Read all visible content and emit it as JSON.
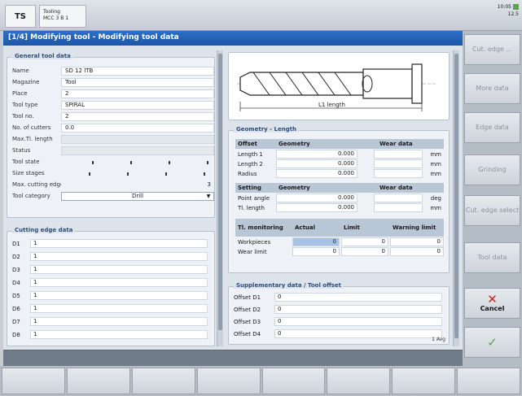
{
  "header": {
    "ts_label": "TS",
    "channel_line1": "Tooling",
    "channel_line2": "MCC 3 B 1",
    "status_line1": "10:05",
    "status_line2": "12.5"
  },
  "title": "[1/4] Modifying tool - Modifying tool data",
  "general": {
    "title": "General tool data",
    "rows": [
      {
        "label": "Name",
        "value": "SD 12 ITB"
      },
      {
        "label": "Magazine",
        "value": "Tool"
      },
      {
        "label": "Place",
        "value": "2"
      },
      {
        "label": "Tool type",
        "value": "SPIRAL"
      },
      {
        "label": "Tool no.",
        "value": "2"
      },
      {
        "label": "No. of cutters",
        "value": "0.0"
      },
      {
        "label": "Max.Tl. length",
        "value": ""
      },
      {
        "label": "Status",
        "value": ""
      }
    ],
    "state_label": "Tool state",
    "size_label": "Size stages",
    "max_cuts_label": "Max. cutting edges",
    "max_cuts_value": "3",
    "direction_label": "Tool category",
    "direction_value": "Drill"
  },
  "edges": {
    "title": "Cutting edge data",
    "rows": [
      {
        "label": "D1",
        "value": "1"
      },
      {
        "label": "D2",
        "value": "1"
      },
      {
        "label": "D3",
        "value": "1"
      },
      {
        "label": "D4",
        "value": "1"
      },
      {
        "label": "D5",
        "value": "1"
      },
      {
        "label": "D6",
        "value": "1"
      },
      {
        "label": "D7",
        "value": "1"
      },
      {
        "label": "D8",
        "value": "1"
      }
    ]
  },
  "diagram": {
    "caption": "L1 length"
  },
  "geometry": {
    "title": "Geometry - Length",
    "header": [
      "Offset",
      "Geometry",
      "",
      "Wear data"
    ],
    "rows": [
      {
        "label": "Length 1",
        "value": "0.000",
        "unit": "mm"
      },
      {
        "label": "Length 2",
        "value": "0.000",
        "unit": "mm"
      },
      {
        "label": "Radius",
        "value": "0.000",
        "unit": "mm"
      }
    ],
    "header2": [
      "Setting",
      "Geometry",
      "",
      "Wear data"
    ],
    "rows2": [
      {
        "label": "Point angle",
        "value": "0.000",
        "unit": "deg"
      },
      {
        "label": "Tl. length",
        "value": "0.000",
        "unit": "mm"
      }
    ],
    "header3": [
      "Tl. monitoring",
      "Actual",
      "Limit",
      "Warning limit"
    ],
    "rows3": [
      {
        "label": "Workpieces",
        "actual": "0",
        "limit": "0",
        "warn": "0"
      },
      {
        "label": "Wear limit",
        "actual": "0",
        "limit": "0",
        "warn": "0"
      }
    ]
  },
  "override": {
    "title": "Supplementary data / Tool offset",
    "rows": [
      {
        "label": "Offset D1",
        "value": "0"
      },
      {
        "label": "Offset D2",
        "value": "0"
      },
      {
        "label": "Offset D3",
        "value": "0"
      },
      {
        "label": "Offset D4",
        "value": "0"
      }
    ],
    "page_label": "1 Avg"
  },
  "softkeys": {
    "k1": "Cut. edge ...",
    "k2": "More data",
    "k3": "Edge data",
    "k4": "Grinding",
    "k5": "Cut. edge select",
    "k6": "Tool data",
    "cancel": "Cancel",
    "ok": "OK"
  }
}
